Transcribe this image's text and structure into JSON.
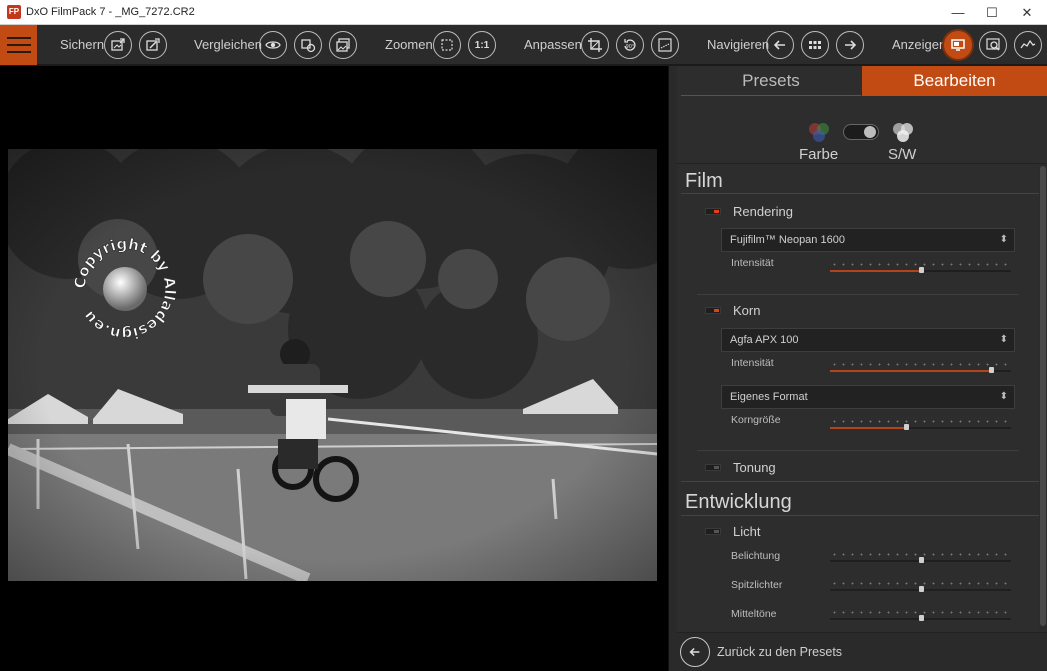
{
  "window": {
    "app_icon": "FP",
    "title": "DxO FilmPack 7 - _MG_7272.CR2",
    "minimize": "—",
    "maximize": "☐",
    "close": "✕"
  },
  "toolbar": {
    "groups": {
      "save": "Sichern",
      "compare": "Vergleichen",
      "zoom": "Zoomen",
      "adjust": "Anpassen",
      "navigate": "Navigieren",
      "view": "Anzeigen"
    },
    "zoom_one_to_one": "1:1",
    "rotate_label": "90°"
  },
  "panel": {
    "tabs": {
      "presets": "Presets",
      "edit": "Bearbeiten"
    },
    "mode": {
      "color_label": "Farbe",
      "bw_label": "S/W"
    },
    "film": {
      "title": "Film",
      "rendering": {
        "label": "Rendering",
        "enabled": true,
        "film_select": "Fujifilm™ Neopan 1600",
        "intensity_label": "Intensität",
        "intensity_value": 0.5
      },
      "grain": {
        "label": "Korn",
        "enabled": true,
        "film_select": "Agfa APX 100",
        "intensity_label": "Intensität",
        "intensity_value": 0.89,
        "format_select": "Eigenes Format",
        "size_label": "Korngröße",
        "size_value": 0.42
      },
      "toning": {
        "label": "Tonung",
        "enabled": false
      }
    },
    "development": {
      "title": "Entwicklung",
      "light": {
        "label": "Licht",
        "enabled": false,
        "exposure_label": "Belichtung",
        "exposure_value": 0.5,
        "highlights_label": "Spitzlichter",
        "highlights_value": 0.5,
        "midtones_label": "Mitteltöne",
        "midtones_value": 0.5
      }
    },
    "back_label": "Zurück zu den Presets"
  },
  "accent_color": "#c24b14"
}
